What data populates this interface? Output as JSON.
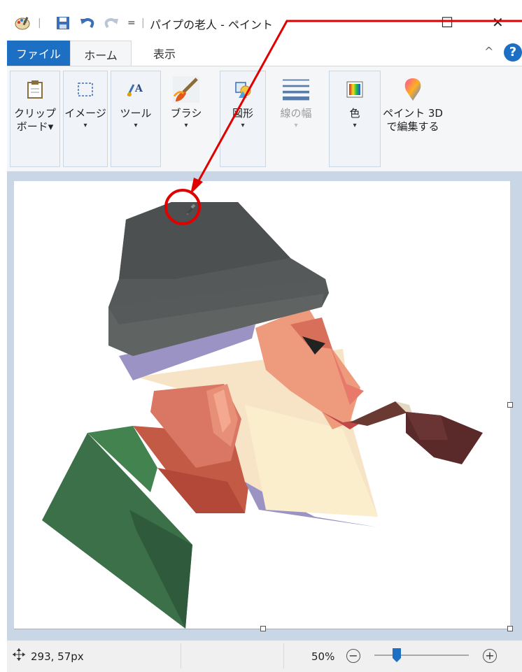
{
  "window": {
    "title": "パイプの老人 - ペイント",
    "qa_dropdown": "=",
    "maximize": "☐",
    "close": "✕",
    "collapse": "^",
    "help": "?"
  },
  "tabs": [
    {
      "label": "ファイル"
    },
    {
      "label": "ホーム"
    },
    {
      "label": "表示"
    }
  ],
  "ribbon": {
    "clipboard": "クリップ\nボード▾",
    "image": "イメージ",
    "tools": "ツール",
    "brush": "ブラシ",
    "shapes": "図形",
    "line_width": "線の幅",
    "color": "色",
    "paint3d": "ペイント 3D\nで編集する",
    "drop": "▾"
  },
  "status": {
    "coords": "293, 57px",
    "zoom": "50%",
    "zoom_level": 0.5
  },
  "colors": {
    "file_tab": "#1c6fc3",
    "annotation": "#e00000"
  }
}
